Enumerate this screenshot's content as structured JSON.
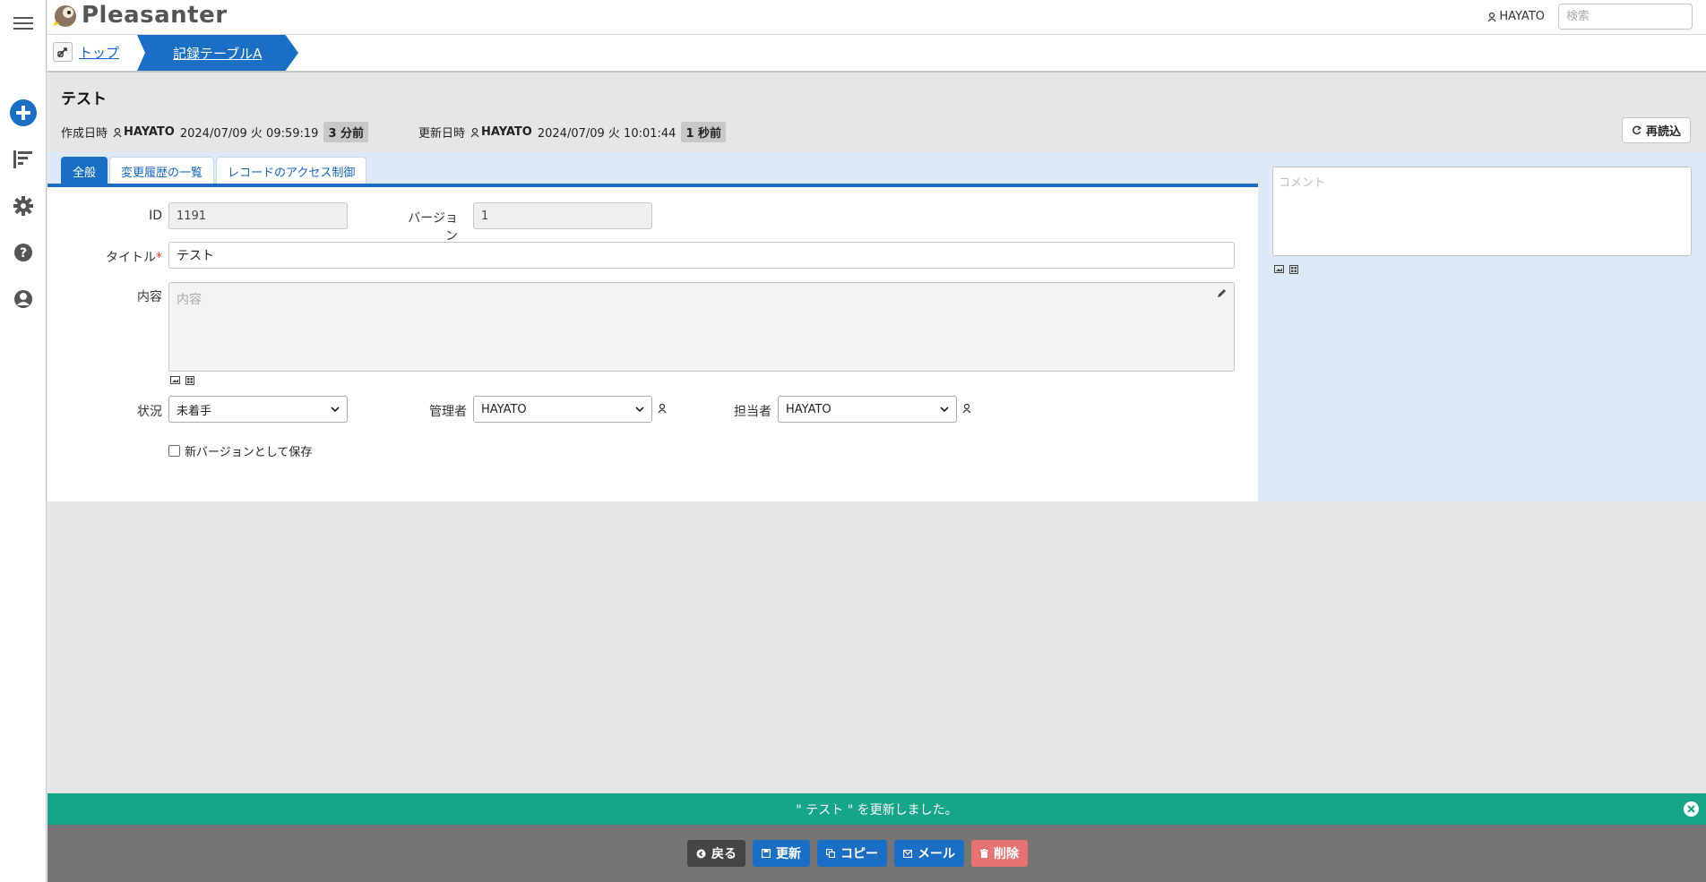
{
  "app": {
    "logo": "Pleasanter"
  },
  "header": {
    "user": "HAYATO",
    "search_placeholder": "検索"
  },
  "breadcrumb": {
    "top": "トップ",
    "current": "記録テーブルA"
  },
  "page": {
    "title": "テスト",
    "created_label": "作成日時",
    "created_user": "HAYATO",
    "created_at": "2024/07/09 火 09:59:19",
    "created_ago": "3 分前",
    "updated_label": "更新日時",
    "updated_user": "HAYATO",
    "updated_at": "2024/07/09 火 10:01:44",
    "updated_ago": "1 秒前",
    "reload_label": "再読込"
  },
  "tabs": [
    {
      "label": "全般"
    },
    {
      "label": "変更履歴の一覧"
    },
    {
      "label": "レコードのアクセス制御"
    }
  ],
  "form": {
    "id_label": "ID",
    "id_value": "1191",
    "version_label": "バージョン",
    "version_value": "1",
    "title_label": "タイトル",
    "title_required": "*",
    "title_value": "テスト",
    "body_label": "内容",
    "body_placeholder": "内容",
    "status_label": "状況",
    "status_value": "未着手",
    "manager_label": "管理者",
    "manager_value": "HAYATO",
    "owner_label": "担当者",
    "owner_value": "HAYATO",
    "save_as_new_label": "新バージョンとして保存"
  },
  "comment": {
    "placeholder": "コメント"
  },
  "message": {
    "text": "\" テスト \" を更新しました。"
  },
  "footer": {
    "back": "戻る",
    "update": "更新",
    "copy": "コピー",
    "mail": "メール",
    "delete": "削除"
  },
  "colors": {
    "accent": "#1a6fc4",
    "success": "#17a589",
    "danger": "#e57373"
  }
}
